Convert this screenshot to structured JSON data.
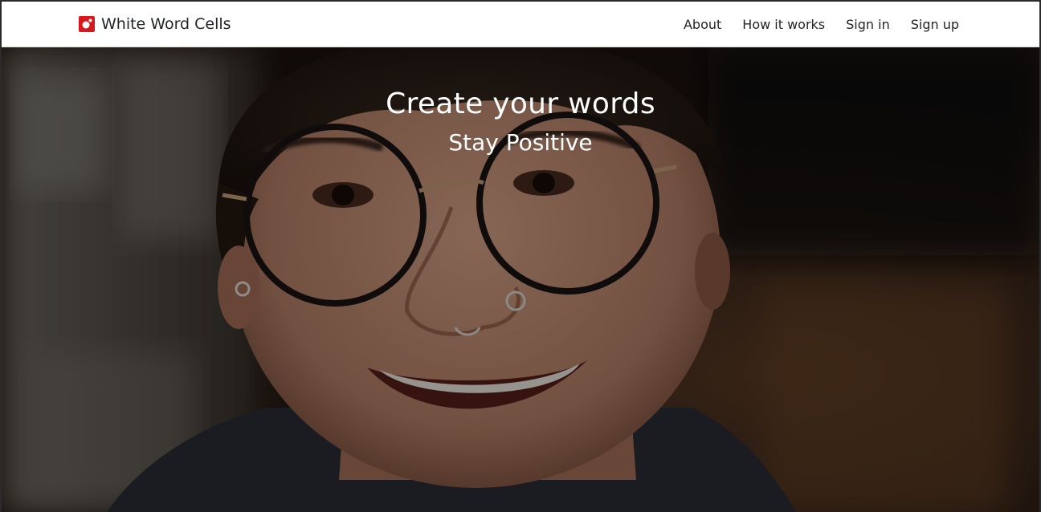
{
  "nav": {
    "brand": "White Word Cells",
    "links": [
      {
        "label": "About"
      },
      {
        "label": "How it works"
      },
      {
        "label": "Sign in"
      },
      {
        "label": "Sign up"
      }
    ]
  },
  "hero": {
    "title": "Create your words",
    "subtitle": "Stay Positive"
  },
  "colors": {
    "brand_red": "#d7191f",
    "navbar_bg": "#ffffff",
    "hero_text": "#ffffff"
  }
}
